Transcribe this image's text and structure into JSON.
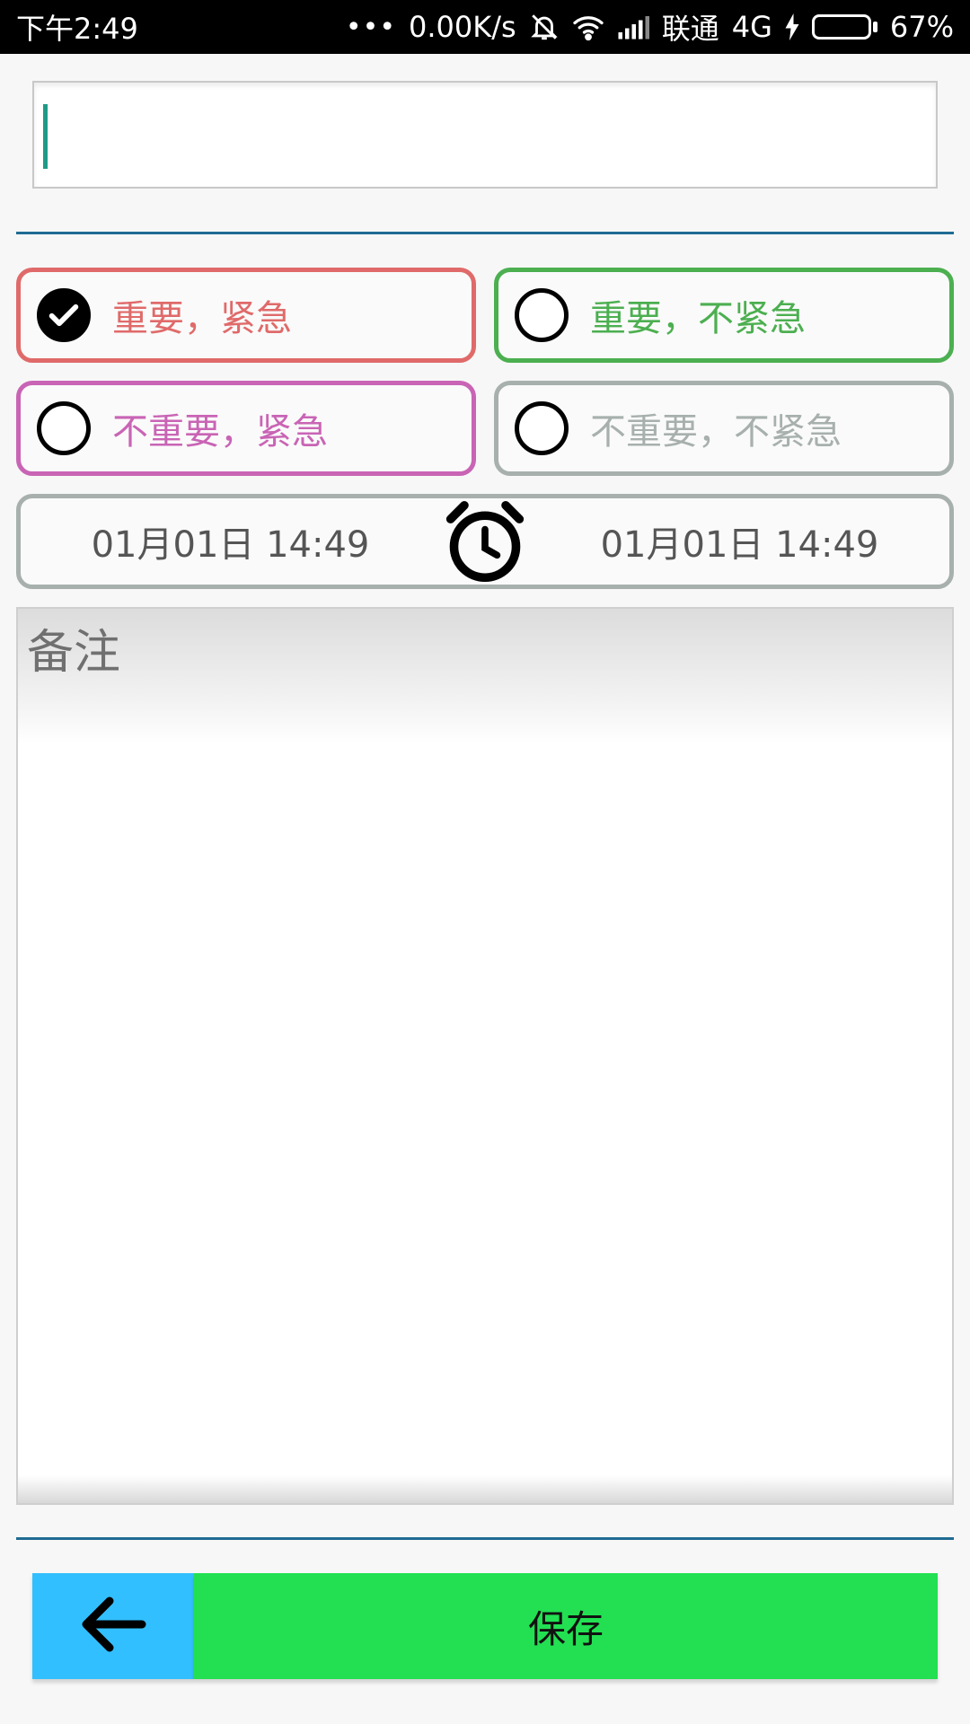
{
  "status_bar": {
    "time": "下午2:49",
    "dots": "•••",
    "speed": "0.00K/s",
    "carrier": "联通",
    "network": "4G",
    "battery": "67%",
    "battery_level": 0.67,
    "icons": [
      "bell-off-icon",
      "wifi-icon",
      "signal-icon",
      "charging-icon",
      "battery-icon"
    ]
  },
  "title_input": {
    "value": "",
    "placeholder": ""
  },
  "priority": {
    "options": [
      {
        "label": "重要，紧急",
        "checked": true,
        "color": "#e06a6a"
      },
      {
        "label": "重要，不紧急",
        "checked": false,
        "color": "#4caf50"
      },
      {
        "label": "不重要，紧急",
        "checked": false,
        "color": "#c964b5"
      },
      {
        "label": "不重要，不紧急",
        "checked": false,
        "color": "#a7b0ad"
      }
    ]
  },
  "time": {
    "start": "01月01日 14:49",
    "end": "01月01日 14:49",
    "icon": "alarm-clock-icon"
  },
  "notes": {
    "placeholder": "备注",
    "value": ""
  },
  "actions": {
    "back_icon": "arrow-left-icon",
    "back_color": "#32bfff",
    "save_label": "保存",
    "save_color": "#22e052"
  }
}
